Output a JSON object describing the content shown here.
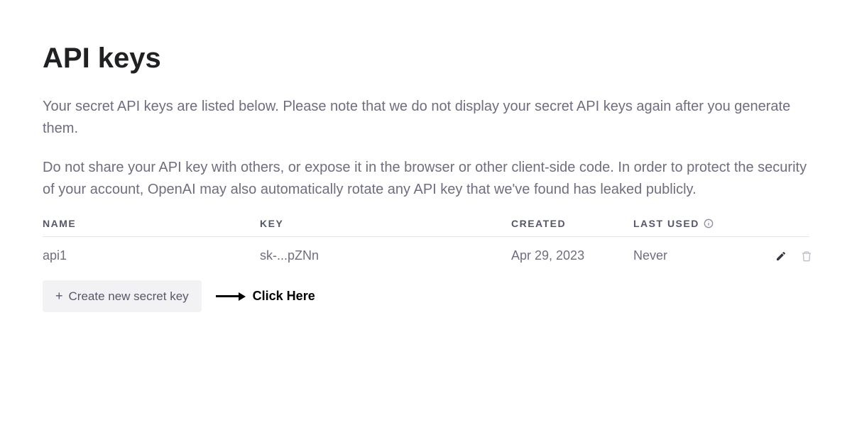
{
  "page": {
    "title": "API keys",
    "description1": "Your secret API keys are listed below. Please note that we do not display your secret API keys again after you generate them.",
    "description2": "Do not share your API key with others, or expose it in the browser or other client-side code. In order to protect the security of your account, OpenAI may also automatically rotate any API key that we've found has leaked publicly."
  },
  "table": {
    "headers": {
      "name": "NAME",
      "key": "KEY",
      "created": "CREATED",
      "lastUsed": "LAST USED"
    },
    "rows": [
      {
        "name": "api1",
        "key": "sk-...pZNn",
        "created": "Apr 29, 2023",
        "lastUsed": "Never"
      }
    ]
  },
  "actions": {
    "createButton": "Create new secret key"
  },
  "annotation": {
    "text": "Click Here"
  }
}
